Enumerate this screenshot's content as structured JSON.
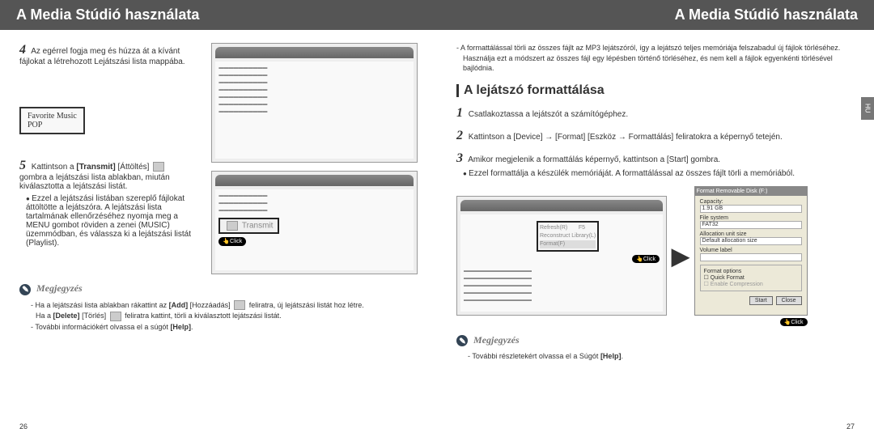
{
  "left": {
    "header": "A Media Stúdió használata",
    "step4": {
      "num": "4",
      "text": "Az egérrel fogja meg és húzza át a kívánt fájlokat a létrehozott Lejátszási lista mappába."
    },
    "callout": {
      "line1": "Favorite Music",
      "line2": "POP"
    },
    "step5": {
      "num": "5",
      "before": "Kattintson a",
      "bold": "[Transmit]",
      "after": "[Áttöltés]",
      "body": "gombra a lejátszási lista ablakban, miután kiválasztotta a lejátszási listát.",
      "bullet": "Ezzel a lejátszási listában szereplő fájlokat áttöltötte a lejátszóra. A lejátszási lista tartalmának ellenőrzéséhez nyomja meg a MENU gombot röviden a zenei (MUSIC) üzemmódban, és válassza ki a lejátszási listát (Playlist)."
    },
    "transmit_label": "Transmit",
    "click": "Click",
    "notes": {
      "title": "Megjegyzés",
      "l1a": "- Ha a lejátszási lista ablakban rákattint az",
      "l1b": "[Add]",
      "l1c": "[Hozzáadás]",
      "l1d": "feliratra, új lejátszási listát hoz létre.",
      "l2a": "Ha a",
      "l2b": "[Delete]",
      "l2c": "[Törlés]",
      "l2d": "feliratra kattint, törli a kiválasztott lejátszási listát.",
      "l3a": "- További információkért olvassa el a súgót",
      "l3b": "[Help]"
    },
    "pagenum": "26"
  },
  "right": {
    "header": "A Media Stúdió használata",
    "intro": {
      "l1": "- A formattálással törli az összes fájlt az MP3 lejátszóról, így a lejátszó teljes memóriája felszabadul új fájlok törléséhez.",
      "l2": "Használja ezt a módszert az összes fájl egy lépésben történő törléséhez, és nem kell a fájlok egyenkénti törlésével bajlódnia."
    },
    "section": "A lejátszó formattálása",
    "step1": {
      "num": "1",
      "text": "Csatlakoztassa a lejátszót a számítógéphez."
    },
    "step2": {
      "num": "2",
      "text": "Kattintson a [Device] → [Format] [Eszköz → Formattálás] feliratokra a képernyő tetején."
    },
    "step3": {
      "num": "3",
      "text": "Amikor megjelenik a formattálás képernyő, kattintson a [Start] gombra.",
      "bullet": "Ezzel formattálja a készülék memóriáját. A formattálással az összes fájlt törli a memóriából."
    },
    "drop": {
      "a": "Refresh(R)",
      "b": "Reconstruct Library(L)",
      "c": "Format(F)",
      "f5": "F5"
    },
    "click": "Click",
    "dialog": {
      "hdr": "Format Removable Disk (F:)",
      "capacity": "Capacity:",
      "capval": "1.91 GB",
      "filesys": "File system",
      "fsval": "FAT32",
      "alloc": "Allocation unit size",
      "allocval": "Default allocation size",
      "vol": "Volume label",
      "grp": "Format options",
      "opt1": "Quick Format",
      "opt2": "Enable Compression",
      "start": "Start",
      "close": "Close"
    },
    "notes": {
      "title": "Megjegyzés",
      "l1a": "- További részletekért olvassa el a Súgót",
      "l1b": "[Help]"
    },
    "tab": "HU",
    "pagenum": "27"
  }
}
